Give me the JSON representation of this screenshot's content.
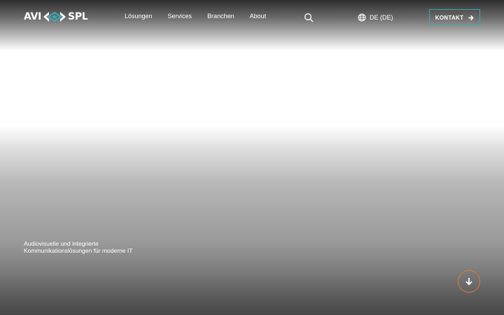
{
  "brand": {
    "logo_left": "AVI",
    "logo_right": "SPL",
    "accent_color": "#3aa8b5",
    "orange_color": "#e07a2e"
  },
  "nav": {
    "items": [
      {
        "label": "Lösungen"
      },
      {
        "label": "Services"
      },
      {
        "label": "Branchen"
      },
      {
        "label": "About"
      }
    ]
  },
  "header": {
    "search_icon": "search-icon",
    "language_icon": "globe-icon",
    "language_label": "DE (DE)",
    "contact_label": "KONTAKT",
    "contact_icon": "arrow-right-icon"
  },
  "hero": {
    "tagline_line1": "Audiovisuelle und integrierte",
    "tagline_line2": "Kommunikationslösungen für moderne IT",
    "scroll_icon": "arrow-down-icon"
  }
}
